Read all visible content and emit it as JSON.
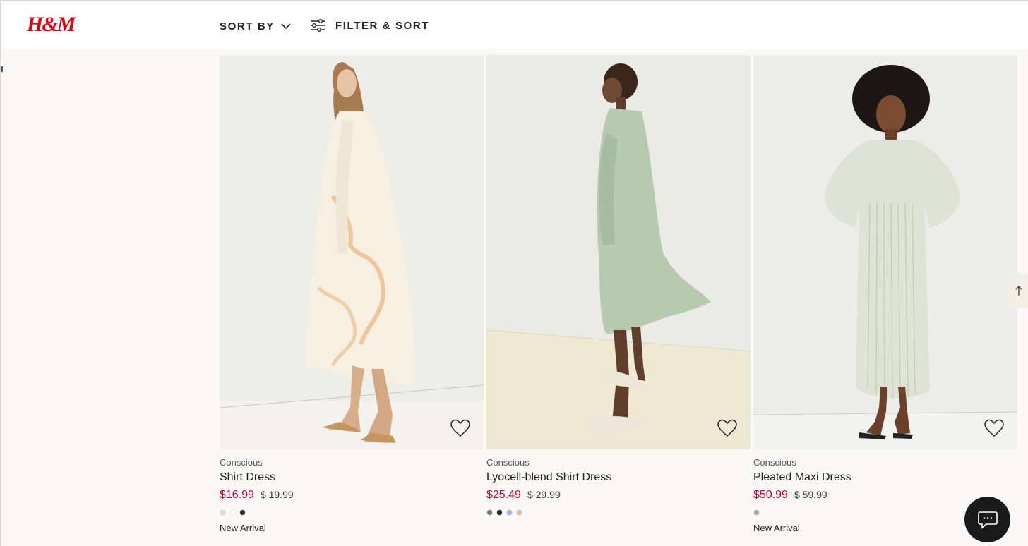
{
  "header": {
    "logo_text": "H&M",
    "sort_label": "SORT BY",
    "filter_label": "FILTER & SORT"
  },
  "products": [
    {
      "tag": "Conscious",
      "name": "Shirt Dress",
      "price": "$16.99",
      "old_price": "$ 19.99",
      "swatches": [
        "#ecd6cf",
        "#ffffff",
        "#2b2b2b"
      ],
      "badge": "New Arrival"
    },
    {
      "tag": "Conscious",
      "name": "Lyocell-blend Shirt Dress",
      "price": "$25.49",
      "old_price": "$ 29.99",
      "swatches": [
        "#6f7a72",
        "#1f1f1f",
        "#9fb3d6",
        "#e8b69c"
      ],
      "badge": ""
    },
    {
      "tag": "Conscious",
      "name": "Pleated Maxi Dress",
      "price": "$50.99",
      "old_price": "$ 59.99",
      "swatches": [
        "#a9a9a6"
      ],
      "badge": "New Arrival"
    }
  ],
  "icons": {
    "sort_chevron": "chevron-down-icon",
    "filter": "filter-sliders-icon",
    "favorite": "heart-icon",
    "scroll_top": "arrow-up-icon",
    "chat": "chat-bubble-icon"
  },
  "colors": {
    "brand_red": "#e50010",
    "sale_price": "#c8003c",
    "page_bg": "#faf9f8"
  }
}
